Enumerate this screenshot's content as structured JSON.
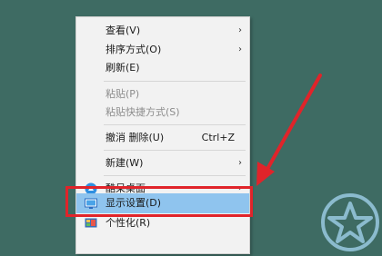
{
  "context_menu": {
    "items": [
      {
        "label": "查看(V)",
        "submenu": "›"
      },
      {
        "label": "排序方式(O)",
        "submenu": "›"
      },
      {
        "label": "刷新(E)"
      },
      {
        "label": "粘贴(P)"
      },
      {
        "label": "粘贴快捷方式(S)"
      },
      {
        "label": "撤消 删除(U)",
        "shortcut": "Ctrl+Z"
      },
      {
        "label": "新建(W)",
        "submenu": "›"
      },
      {
        "label": "酷呆桌面",
        "submenu": "›"
      },
      {
        "label": "显示设置(D)"
      },
      {
        "label": "个性化(R)"
      }
    ]
  },
  "colors": {
    "desktop": "#3e6b63",
    "highlight": "#8fc4ee",
    "annotation_red": "#e0242a"
  },
  "icons": [
    "kudai-desktop-icon",
    "display-icon",
    "personalize-icon",
    "star-watermark-icon"
  ]
}
